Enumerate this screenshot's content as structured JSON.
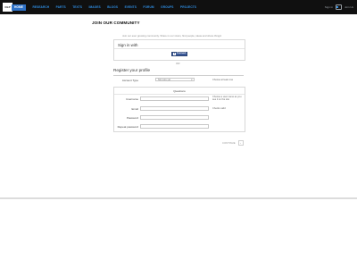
{
  "header": {
    "logo_text": "OLP",
    "nav": [
      "HOME",
      "RESEARCH",
      "PARTS",
      "TEXTS",
      "IMAGES",
      "BLOGS",
      "EVENTS",
      "FORUM",
      "GROUPS",
      "PROJECTS"
    ],
    "active_nav_index": 0,
    "right": {
      "sign_in": "Sign in",
      "join": "Join Us"
    }
  },
  "page": {
    "title": "JOIN OUR COMMUNITY",
    "intro": "Join our ever growing community. Share in our vision, find people, ideas and share things!"
  },
  "signin": {
    "title": "Sign in with",
    "facebook_label": "Connect",
    "facebook_icon": "facebook-icon"
  },
  "or_text": "OR",
  "register": {
    "title": "Register your profile",
    "account_type_label": "Account Type",
    "account_type_value": "Not sure yet",
    "account_type_hint": "Choose at least one",
    "questions_title": "Questions",
    "fields": [
      {
        "label": "Username",
        "value": "",
        "hint": "Choose a user name as you see it on the site"
      },
      {
        "label": "Email",
        "value": "",
        "hint": "Checks valid"
      },
      {
        "label": "Password",
        "value": "",
        "hint": ""
      },
      {
        "label": "Repeat password",
        "value": "",
        "hint": ""
      }
    ],
    "continue_label": "CONTINUE",
    "continue_icon": "arrow-right-icon"
  },
  "colors": {
    "header_bg": "#101010",
    "nav_link": "#2f8fe5",
    "nav_active_bg": "#2f72c7",
    "facebook": "#3b5998"
  }
}
